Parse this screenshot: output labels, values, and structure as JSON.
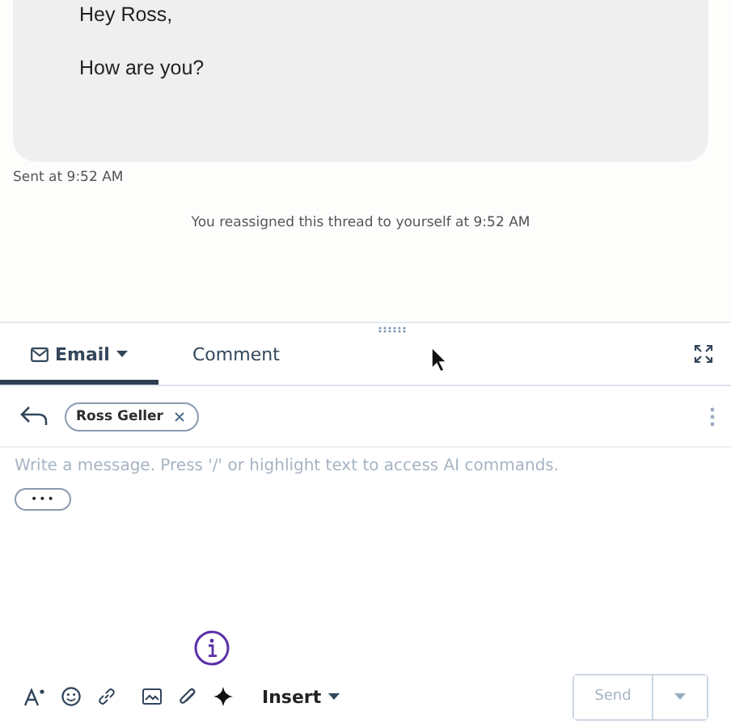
{
  "message": {
    "lines": [
      "Hey Ross,",
      "How are you?"
    ],
    "sent": "Sent at 9:52 AM"
  },
  "activity": "You reassigned this thread to yourself at 9:52 AM",
  "tabs": [
    {
      "label": "Email",
      "selected": true,
      "kind": "dropdown"
    },
    {
      "label": "Comment",
      "selected": false,
      "kind": "plain"
    }
  ],
  "recipients": [
    {
      "name": "Ross Geller"
    }
  ],
  "composer": {
    "placeholder": "Write a message. Press '/' or highlight text to access AI commands.",
    "more": "•••"
  },
  "toolbar": {
    "insert": "Insert"
  },
  "send": {
    "label": "Send",
    "disabled": true
  }
}
